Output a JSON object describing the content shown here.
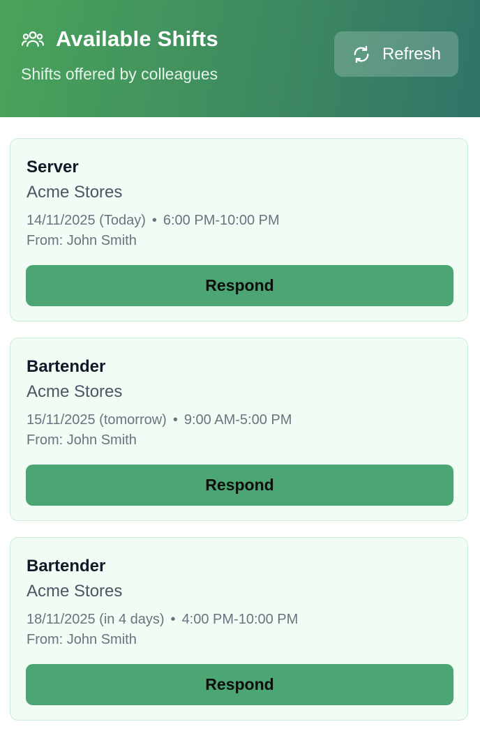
{
  "header": {
    "title": "Available Shifts",
    "subtitle": "Shifts offered by colleagues",
    "icon": "users-icon",
    "refresh_label": "Refresh",
    "refresh_icon": "refresh-icon"
  },
  "shifts": [
    {
      "role": "Server",
      "company": "Acme Stores",
      "date": "14/11/2025 (Today)",
      "separator": "•",
      "time": "6:00 PM-10:00 PM",
      "from": "From: John Smith",
      "action_label": "Respond"
    },
    {
      "role": "Bartender",
      "company": "Acme Stores",
      "date": "15/11/2025 (tomorrow)",
      "separator": "•",
      "time": "9:00 AM-5:00 PM",
      "from": "From: John Smith",
      "action_label": "Respond"
    },
    {
      "role": "Bartender",
      "company": "Acme Stores",
      "date": "18/11/2025 (in 4 days)",
      "separator": "•",
      "time": "4:00 PM-10:00 PM",
      "from": "From: John Smith",
      "action_label": "Respond"
    }
  ],
  "colors": {
    "header_start": "#4aa35a",
    "header_end": "#2f7468",
    "card_bg": "#f0fcf4",
    "button": "#4ca673"
  }
}
